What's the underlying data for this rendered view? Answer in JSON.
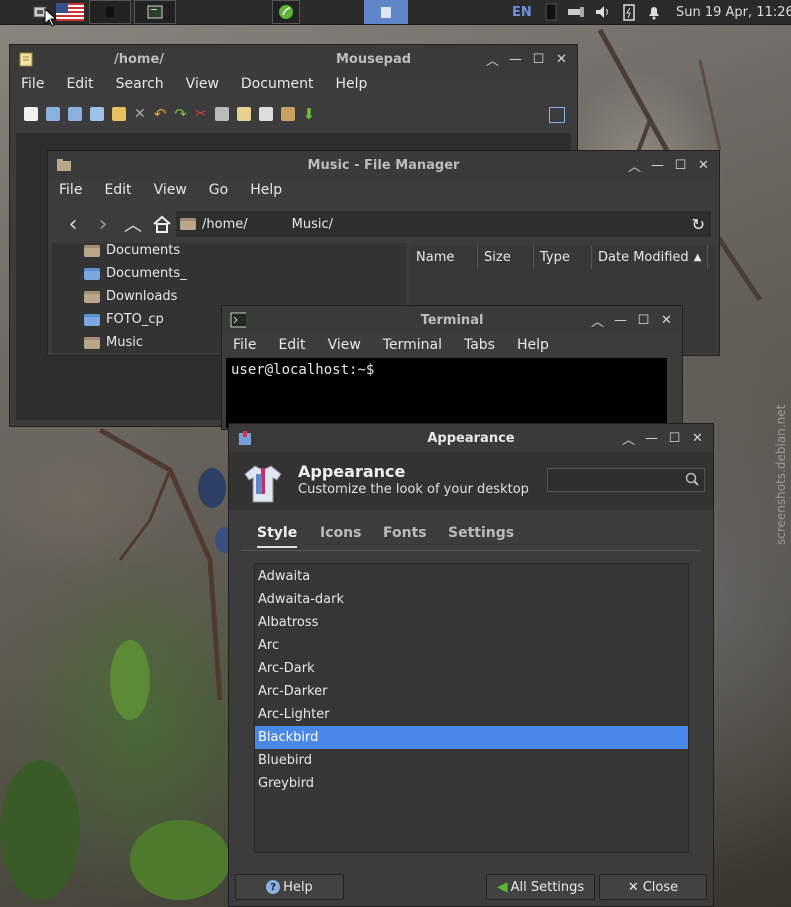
{
  "taskbar": {
    "clock": "Sun 19 Apr, 11:26",
    "keyboard_layout": "EN"
  },
  "mousepad": {
    "path": "/home/",
    "title": "Mousepad",
    "menu": [
      "File",
      "Edit",
      "Search",
      "View",
      "Document",
      "Help"
    ]
  },
  "file_manager": {
    "title": "Music - File Manager",
    "menu": [
      "File",
      "Edit",
      "View",
      "Go",
      "Help"
    ],
    "path_root": "/home/",
    "path_leaf": "Music/",
    "sidebar": [
      "Documents",
      "Documents_",
      "Downloads",
      "FOTO_cp",
      "Music"
    ],
    "columns": [
      "Name",
      "Size",
      "Type",
      "Date Modified"
    ]
  },
  "terminal": {
    "title": "Terminal",
    "menu": [
      "File",
      "Edit",
      "View",
      "Terminal",
      "Tabs",
      "Help"
    ],
    "prompt": "user@localhost:~$"
  },
  "appearance": {
    "title": "Appearance",
    "heading": "Appearance",
    "subtitle": "Customize the look of your desktop",
    "search_placeholder": "",
    "tabs": [
      "Style",
      "Icons",
      "Fonts",
      "Settings"
    ],
    "active_tab": "Style",
    "themes": [
      "Adwaita",
      "Adwaita-dark",
      "Albatross",
      "Arc",
      "Arc-Dark",
      "Arc-Darker",
      "Arc-Lighter",
      "Blackbird",
      "Bluebird",
      "Greybird"
    ],
    "selected_theme": "Blackbird",
    "help_label": "Help",
    "all_settings_label": "All Settings",
    "close_label": "Close"
  },
  "watermark": "screenshots.debian.net",
  "colors": {
    "selection": "#4a88e8",
    "window_bg": "#3c3c3c",
    "titlebar": "#3a3a3a",
    "terminal_bg": "#000000",
    "accent_green": "#5fb336"
  },
  "icons": [
    "app-menu-icon",
    "flag-us-icon",
    "keyboard-icon",
    "network-icon",
    "volume-icon",
    "battery-icon",
    "notification-icon",
    "refresh-icon",
    "home-icon",
    "search-icon"
  ]
}
